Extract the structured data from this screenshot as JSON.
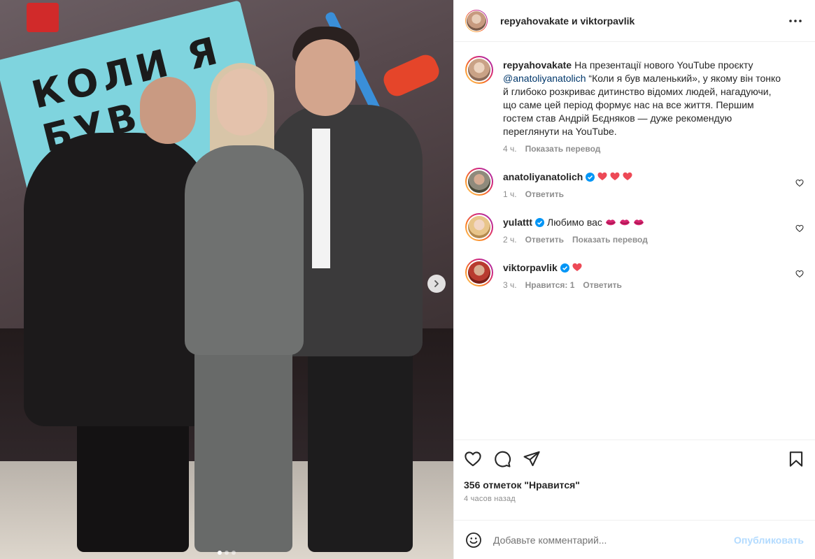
{
  "post": {
    "photo": {
      "sign_text": "КОЛИ Я БУВ МАЛ",
      "carousel_dots": 3,
      "active_dot": 0
    },
    "header": {
      "author": "repyahovakate",
      "connector": " и ",
      "coauthor": "viktorpavlik"
    },
    "caption": {
      "user": "repyahovakate",
      "text_before": "На презентації нового YouTube проєкту ",
      "mention": "@anatoliyanatolich",
      "text_after": " “Коли я був маленький», у якому він тонко й глибоко розкриває дитинство відомих людей, нагадуючи, що саме цей період формує нас на все життя. Першим гостем став Андрій Бєдняков — дуже рекомендую переглянути на YouTube.",
      "time": "4 ч.",
      "translate": "Показать перевод"
    },
    "comments": [
      {
        "user": "anatoliyanatolich",
        "verified": true,
        "emoji": "heart",
        "emoji_count": 3,
        "text": "",
        "time": "1 ч.",
        "actions": [
          "Ответить"
        ]
      },
      {
        "user": "yulattt",
        "verified": true,
        "emoji": "lips",
        "emoji_count": 3,
        "text": "Любимо вас",
        "time": "2 ч.",
        "actions": [
          "Ответить",
          "Показать перевод"
        ]
      },
      {
        "user": "viktorpavlik",
        "verified": true,
        "emoji": "heart",
        "emoji_count": 1,
        "text": "",
        "time": "3 ч.",
        "actions": [
          "Нравится: 1",
          "Ответить"
        ]
      }
    ],
    "likes_text": "356 отметок \"Нравится\"",
    "posted_ago": "4 часов назад",
    "comment_box": {
      "placeholder": "Добавьте комментарий...",
      "publish_label": "Опубликовать"
    },
    "colors": {
      "verified": "#0095f6",
      "heart": "#ed4956",
      "mention": "#00376b",
      "publish_disabled": "#b3dbff"
    },
    "icons": {
      "like": "heart-outline-icon",
      "comment": "speech-bubble-icon",
      "share": "paper-plane-icon",
      "save": "bookmark-icon",
      "more": "more-horizontal-icon",
      "emoji": "smiley-icon",
      "next": "chevron-right-icon"
    }
  }
}
